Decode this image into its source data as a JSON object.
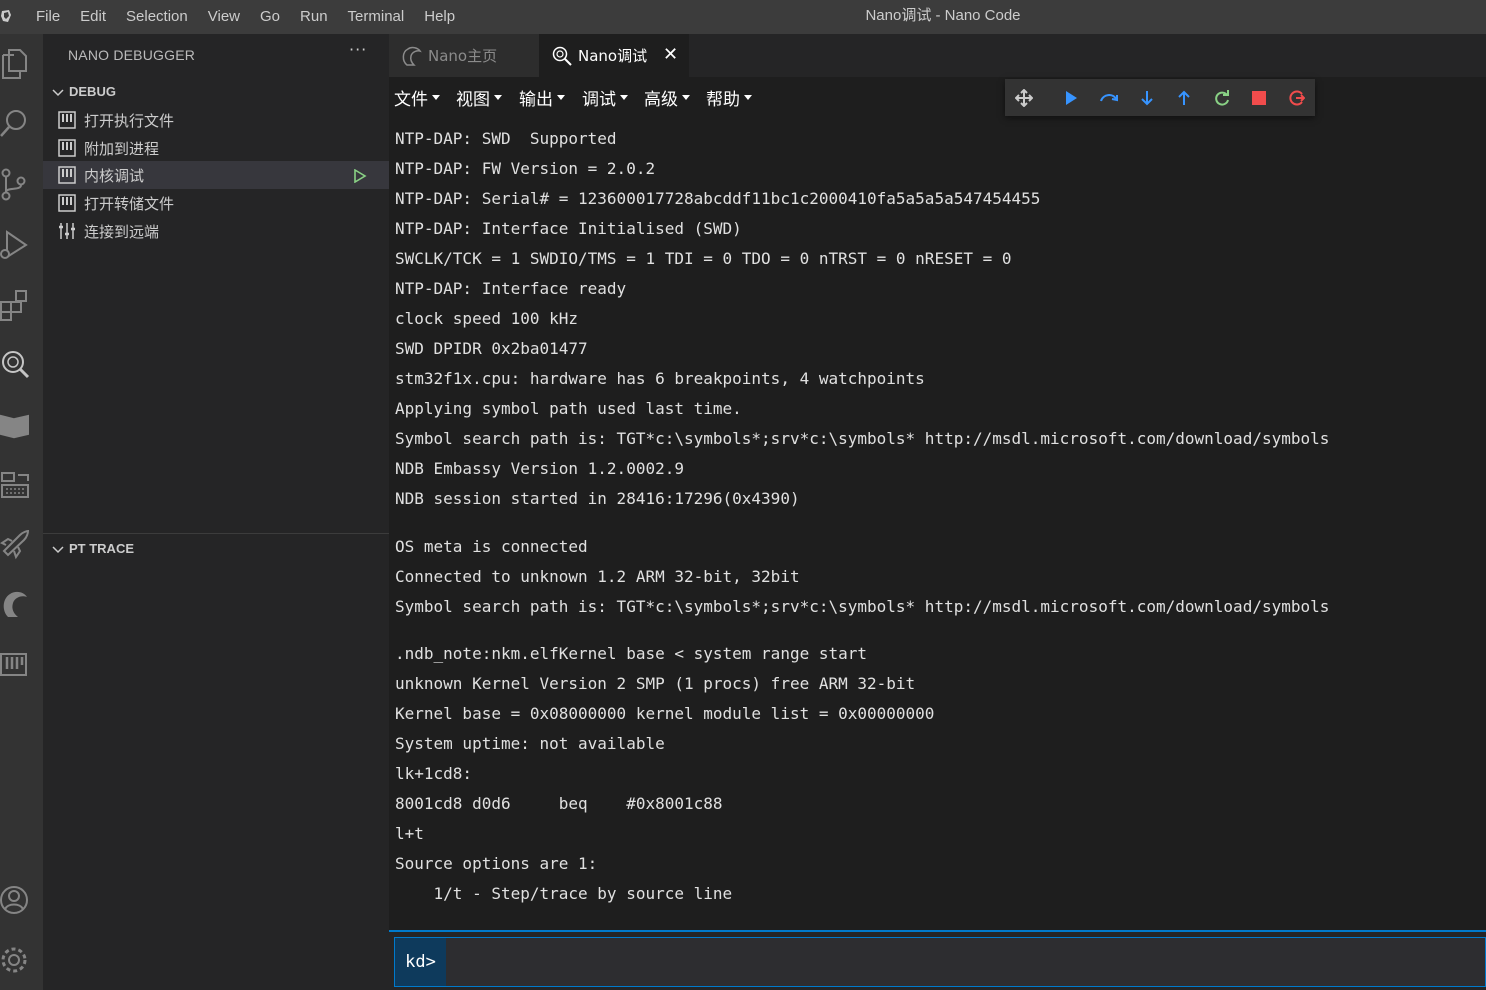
{
  "titlebar": {
    "menus": [
      "File",
      "Edit",
      "Selection",
      "View",
      "Go",
      "Run",
      "Terminal",
      "Help"
    ],
    "title": "Nano调试 - Nano Code"
  },
  "activitybar": {
    "icons": [
      "explorer-icon",
      "search-icon",
      "source-control-icon",
      "run-debug-icon",
      "extensions-icon",
      "debugger-search-icon",
      "book-icon",
      "keyboard-icon",
      "rocket-icon",
      "nano-logo-icon",
      "trace-icon",
      "account-icon",
      "settings-gear-icon"
    ]
  },
  "sidebar": {
    "title": "NANO DEBUGGER",
    "more": "···",
    "debug_section": "DEBUG",
    "items": [
      {
        "label": "打开执行文件",
        "icon": "panel-icon"
      },
      {
        "label": "附加到进程",
        "icon": "panel-icon"
      },
      {
        "label": "内核调试",
        "icon": "panel-icon"
      },
      {
        "label": "打开转储文件",
        "icon": "panel-icon"
      },
      {
        "label": "连接到远端",
        "icon": "sliders-icon"
      }
    ],
    "selected_index": 2,
    "trace_section": "PT TRACE"
  },
  "tabs": [
    {
      "label": "Nano主页",
      "active": false,
      "icon": "nano-logo-icon"
    },
    {
      "label": "Nano调试",
      "active": true,
      "icon": "debug-search-icon"
    }
  ],
  "menu2": [
    {
      "label": "文件"
    },
    {
      "label": "视图"
    },
    {
      "label": "输出"
    },
    {
      "label": "调试"
    },
    {
      "label": "高级"
    },
    {
      "label": "帮助"
    }
  ],
  "debug_toolbar": [
    {
      "name": "drag-handle-icon",
      "color": "#cccccc"
    },
    {
      "name": "continue-icon",
      "color": "#3794ff"
    },
    {
      "name": "step-over-icon",
      "color": "#3794ff"
    },
    {
      "name": "step-into-icon",
      "color": "#3794ff"
    },
    {
      "name": "step-out-icon",
      "color": "#3794ff"
    },
    {
      "name": "restart-icon",
      "color": "#89d185"
    },
    {
      "name": "stop-icon",
      "color": "#f14c4c"
    },
    {
      "name": "disconnect-icon",
      "color": "#f14c4c"
    }
  ],
  "output": {
    "lines": [
      "NTP-DAP: SWD  Supported",
      "NTP-DAP: FW Version = 2.0.2",
      "NTP-DAP: Serial# = 123600017728abcddf11bc1c2000410fa5a5a5a547454455",
      "NTP-DAP: Interface Initialised (SWD)",
      "SWCLK/TCK = 1 SWDIO/TMS = 1 TDI = 0 TDO = 0 nTRST = 0 nRESET = 0",
      "NTP-DAP: Interface ready",
      "clock speed 100 kHz",
      "SWD DPIDR 0x2ba01477",
      "stm32f1x.cpu: hardware has 6 breakpoints, 4 watchpoints",
      "Applying symbol path used last time.",
      "Symbol search path is: TGT*c:\\symbols*;srv*c:\\symbols* http://msdl.microsoft.com/download/symbols",
      "NDB Embassy Version 1.2.0002.9",
      "NDB session started in 28416:17296(0x4390)",
      "OS meta is connected",
      "Connected to unknown 1.2 ARM 32-bit, 32bit",
      "Symbol search path is: TGT*c:\\symbols*;srv*c:\\symbols* http://msdl.microsoft.com/download/symbols",
      ".ndb_note:nkm.elfKernel base < system range start",
      "unknown Kernel Version 2 SMP (1 procs) free ARM 32-bit",
      "Kernel base = 0x08000000 kernel module list = 0x00000000",
      "System uptime: not available",
      "lk+1cd8:",
      "8001cd8 d0d6     beq    #0x8001c88",
      "l+t",
      "Source options are 1:",
      "    1/t - Step/trace by source line"
    ]
  },
  "command": {
    "prompt": "kd>",
    "value": ""
  },
  "colors": {
    "accent": "#007acc",
    "run_green": "#89d185"
  }
}
